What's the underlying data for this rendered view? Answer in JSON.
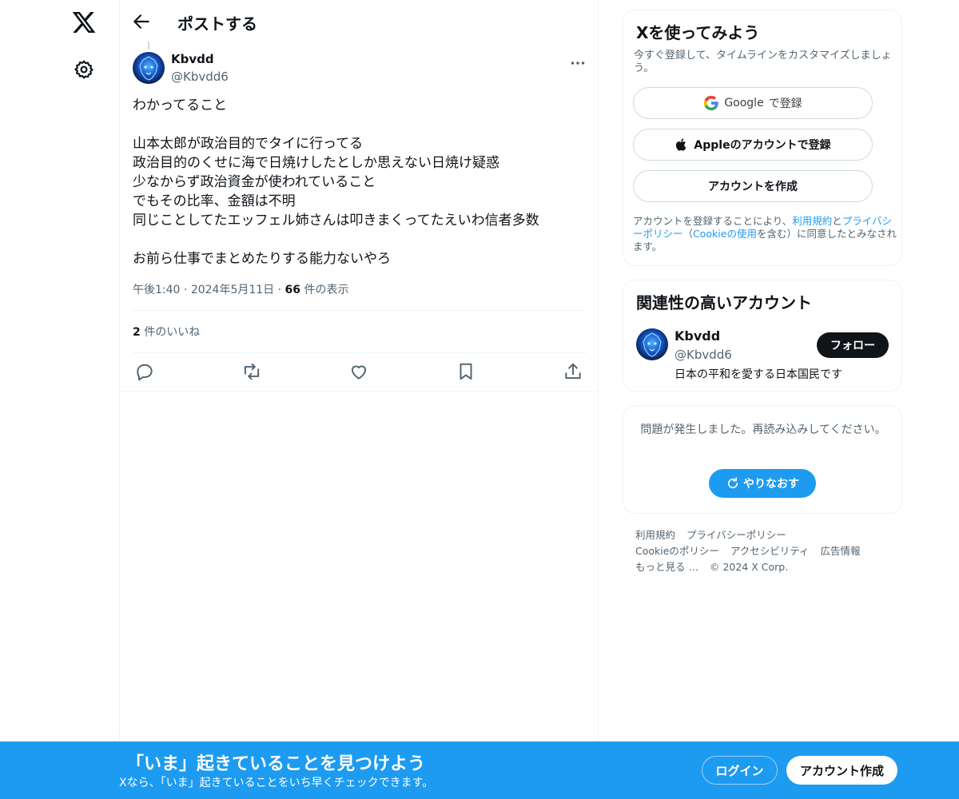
{
  "nav": {
    "logo_icon": "x-logo-icon",
    "settings_icon": "gear-icon"
  },
  "header": {
    "title": "ポストする"
  },
  "post": {
    "author_name": "Kbvdd",
    "author_handle": "@Kbvdd6",
    "text": "わかってること\n\n山本太郎が政治目的でタイに行ってる\n政治目的のくせに海で日焼けしたとしか思えない日焼け疑惑\n少なからず政治資金が使われていること\nでもその比率、金額は不明\n同じことしてたエッフェル姉さんは叩きまくってたえいわ信者多数\n\nお前ら仕事でまとめたりする能力ないやろ",
    "time": "午後1:40",
    "date": "2024年5月11日",
    "views_count": "66",
    "views_label": "件の表示",
    "likes_count": "2",
    "likes_label": "件のいいね"
  },
  "signup": {
    "title": "Xを使ってみよう",
    "subtitle": "今すぐ登録して、タイムラインをカスタマイズしましょう。",
    "google_brand": "Google",
    "google_suffix": "で登録",
    "apple_label": "Appleのアカウントで登録",
    "create_label": "アカウントを作成",
    "terms_pre": "アカウントを登録することにより、",
    "terms_link1": "利用規約",
    "terms_and": "と",
    "terms_link2": "プライバシーポリシー",
    "terms_mid": "（",
    "terms_link3": "Cookieの使用",
    "terms_post": "を含む）に同意したとみなされます。"
  },
  "relevant": {
    "title": "関連性の高いアカウント",
    "name": "Kbvdd",
    "handle": "@Kbvdd6",
    "bio": "日本の平和を愛する日本国民です",
    "follow_label": "フォロー"
  },
  "error": {
    "message": "問題が発生しました。再読み込みしてください。",
    "retry_label": "やりなおす"
  },
  "footer": {
    "links": [
      "利用規約",
      "プライバシーポリシー",
      "Cookieのポリシー",
      "アクセシビリティ",
      "広告情報",
      "もっと見る …",
      "© 2024 X Corp."
    ]
  },
  "banner": {
    "title": "「いま」起きていることを見つけよう",
    "subtitle": "Xなら、「いま」起きていることをいち早くチェックできます。",
    "login_label": "ログイン",
    "create_label": "アカウント作成"
  },
  "colors": {
    "accent": "#1d9bf0",
    "text": "#0f1419",
    "secondary": "#536471",
    "border": "#eff3f4"
  }
}
